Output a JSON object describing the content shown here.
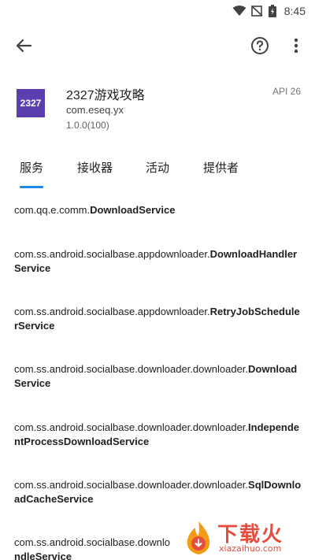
{
  "status_bar": {
    "time": "8:45"
  },
  "toolbar": {
    "back_icon": "arrow-left-icon",
    "help_icon": "help-circle-icon",
    "more_icon": "more-vertical-icon"
  },
  "app": {
    "icon_text": "2327",
    "icon_color": "#5b3fb0",
    "name": "2327游戏攻略",
    "package": "com.eseq.yx",
    "version": "1.0.0(100)",
    "api": "API 26"
  },
  "tabs": [
    {
      "label": "服务",
      "selected": true
    },
    {
      "label": "接收器",
      "selected": false
    },
    {
      "label": "活动",
      "selected": false
    },
    {
      "label": "提供者",
      "selected": false
    }
  ],
  "accent_color": "#1e88e5",
  "services": [
    {
      "prefix": "com.qq.e.comm.",
      "name": "DownloadService"
    },
    {
      "prefix": "com.ss.android.socialbase.appdownloader.",
      "name": "DownloadHandlerService"
    },
    {
      "prefix": "com.ss.android.socialbase.appdownloader.",
      "name": "RetryJobSchedulerService"
    },
    {
      "prefix": "com.ss.android.socialbase.downloader.downloader.",
      "name": "DownloadService"
    },
    {
      "prefix": "com.ss.android.socialbase.downloader.downloader.",
      "name": "IndependentProcessDownloadService"
    },
    {
      "prefix": "com.ss.android.socialbase.downloader.downloader.",
      "name": "SqlDownloadCacheService"
    },
    {
      "prefix": "com.ss.android.socialbase.downlo",
      "name": "ndleService"
    }
  ],
  "watermark": {
    "brand": "下载火",
    "domain": "xiazaihuo.com"
  }
}
